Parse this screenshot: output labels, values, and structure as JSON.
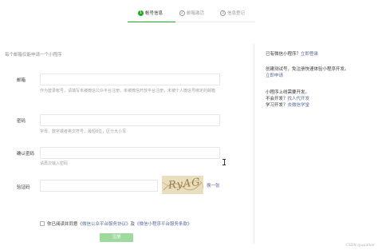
{
  "steps": [
    {
      "num": "1",
      "label": "帐号信息",
      "active": true
    },
    {
      "num": "2",
      "label": "邮箱激活",
      "active": false
    },
    {
      "num": "3",
      "label": "信息登记",
      "active": false
    }
  ],
  "form": {
    "intro": "每个邮箱仅能申请一个小程序",
    "email_label": "邮箱",
    "email_value": "",
    "email_hint": "作为登录帐号，请填写未被微信公众平台注册，未被微信开放平台注册，未被个人微信号绑定的邮箱",
    "password_label": "密码",
    "password_value": "",
    "password_hint": "字母、数字或者英文符号，最短8位，区分大小写",
    "confirm_label": "确认密码",
    "confirm_value": "",
    "confirm_hint": "请再次输入密码",
    "captcha_label": "验证码",
    "captcha_value": "",
    "captcha_text": "RyAG",
    "captcha_swap": "换一张",
    "agree_prefix": "你已阅读并同意",
    "agree_link1": "《微信公众平台服务协议》",
    "agree_and": "及",
    "agree_link2": "《微信小程序平台服务条款》",
    "submit_label": "注册"
  },
  "sidebar": {
    "existing_text": "已有微信小程序？",
    "existing_link": "立即登录",
    "create_line1": "创建测试号，免注册快速体验小程序开发。",
    "create_link": "立即申请",
    "q1": "小程序上线需要开发。",
    "q2_text": "不会开发？",
    "q2_link": "找人代开发",
    "q3_text": "学习开发？",
    "q3_link": "去微信学堂"
  },
  "watermark": "CSDN @uparker",
  "colors": {
    "accent": "#1aad19",
    "link": "#576b95",
    "button_disabled": "#9ed99d"
  }
}
